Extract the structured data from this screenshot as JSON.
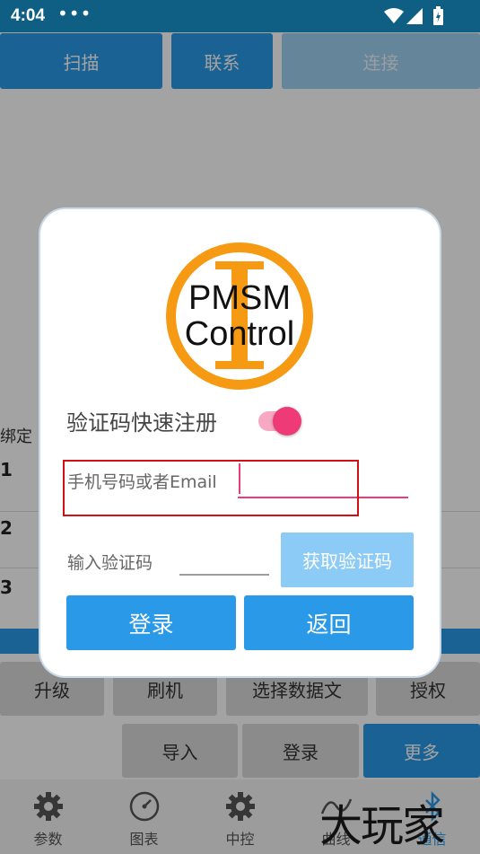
{
  "status_bar": {
    "time": "4:04",
    "dots": "•••"
  },
  "top_buttons": {
    "scan": "扫描",
    "contact": "联系",
    "connect": "连接"
  },
  "background": {
    "side_label": "绑定",
    "rows": [
      "1",
      "2",
      "3"
    ]
  },
  "action_row1": {
    "upgrade": "升级",
    "flash": "刷机",
    "select_data": "选择数据文",
    "authorize": "授权"
  },
  "action_row2": {
    "import": "导入",
    "login": "登录",
    "more": "更多"
  },
  "bottom_nav": [
    {
      "label": "参数",
      "icon": "gear-icon"
    },
    {
      "label": "图表",
      "icon": "gauge-icon"
    },
    {
      "label": "中控",
      "icon": "gear-icon"
    },
    {
      "label": "曲线",
      "icon": "curve-icon"
    },
    {
      "label": "通信",
      "icon": "bluetooth-icon"
    }
  ],
  "dialog": {
    "logo_line1": "PMSM",
    "logo_line2": "Control",
    "quick_register_label": "验证码快速注册",
    "quick_register_on": true,
    "phone_label": "手机号码或者Email",
    "phone_value": "",
    "code_label": "输入验证码",
    "code_value": "",
    "get_code_button": "获取验证码",
    "login_button": "登录",
    "back_button": "返回"
  },
  "watermark": "大玩家",
  "colors": {
    "accent_blue": "#2a9ae8",
    "light_blue": "#8ccbf5",
    "pink": "#ee3b78",
    "logo_orange": "#f59a12",
    "highlight_red": "#d40f14"
  }
}
